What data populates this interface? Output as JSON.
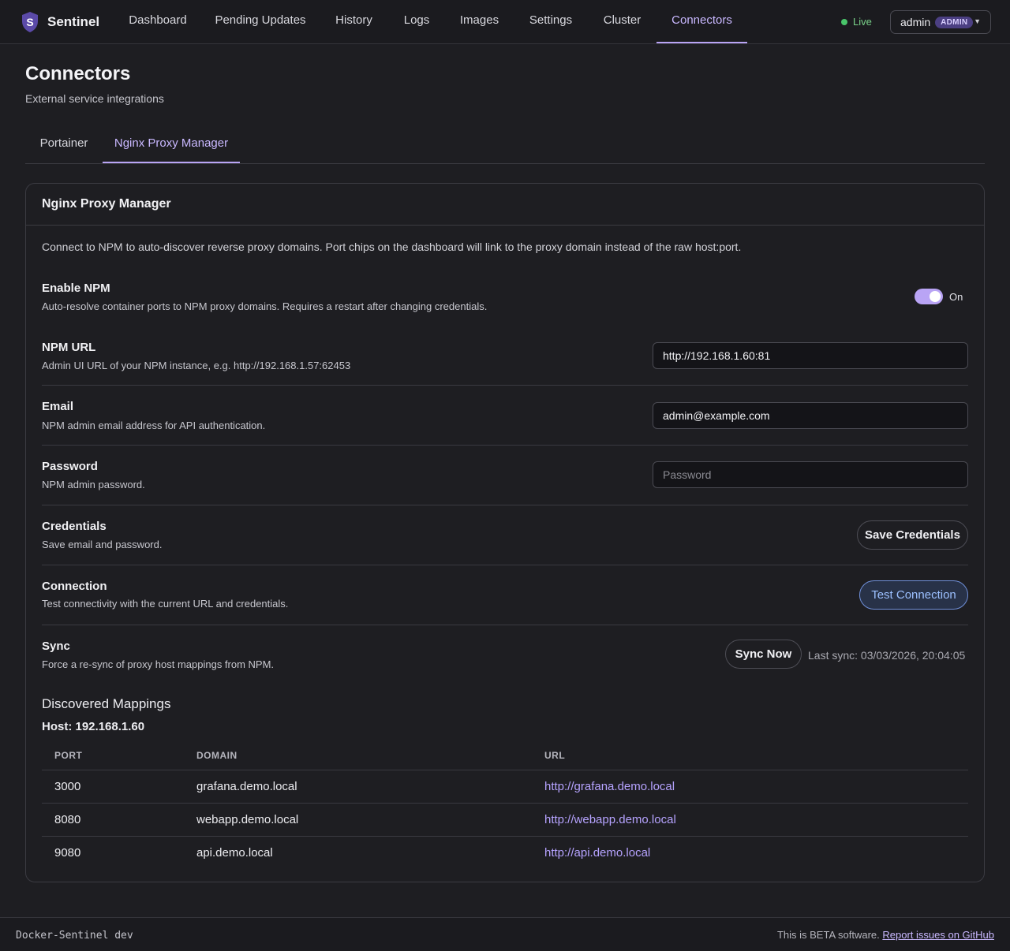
{
  "app": {
    "name": "Sentinel",
    "logo_letter": "S",
    "logo_icon": "shield-icon",
    "accent_color": "#b9a4f5"
  },
  "nav": {
    "items": [
      {
        "label": "Dashboard"
      },
      {
        "label": "Pending Updates"
      },
      {
        "label": "History"
      },
      {
        "label": "Logs"
      },
      {
        "label": "Images"
      },
      {
        "label": "Settings"
      },
      {
        "label": "Cluster"
      },
      {
        "label": "Connectors",
        "active": true
      }
    ],
    "status": "Live",
    "user": {
      "name": "admin",
      "role": "ADMIN",
      "menu_icon": "caret-down-icon"
    }
  },
  "page": {
    "title": "Connectors",
    "subtitle": "External service integrations"
  },
  "tabs": [
    {
      "label": "Portainer"
    },
    {
      "label": "Nginx Proxy Manager",
      "active": true
    }
  ],
  "card": {
    "title": "Nginx Proxy Manager",
    "description": "Connect to NPM to auto-discover reverse proxy domains. Port chips on the dashboard will link to the proxy domain instead of the raw host:port.",
    "enable": {
      "label": "Enable NPM",
      "hint": "Auto-resolve container ports to NPM proxy domains. Requires a restart after changing credentials.",
      "state": "On",
      "enabled": true
    },
    "url": {
      "label": "NPM URL",
      "hint": "Admin UI URL of your NPM instance, e.g. http://192.168.1.57:62453",
      "value": "http://192.168.1.60:81"
    },
    "email": {
      "label": "Email",
      "hint": "NPM admin email address for API authentication.",
      "value": "admin@example.com"
    },
    "password": {
      "label": "Password",
      "hint": "NPM admin password.",
      "placeholder": "Password"
    },
    "credentials": {
      "label": "Credentials",
      "hint": "Save email and password.",
      "button": "Save Credentials"
    },
    "connection": {
      "label": "Connection",
      "hint": "Test connectivity with the current URL and credentials.",
      "button": "Test Connection"
    },
    "sync": {
      "label": "Sync",
      "hint": "Force a re-sync of proxy host mappings from NPM.",
      "button": "Sync Now",
      "last_sync": "Last sync: 03/03/2026, 20:04:05"
    },
    "mappings": {
      "title": "Discovered Mappings",
      "host": "Host: 192.168.1.60",
      "columns": [
        "PORT",
        "DOMAIN",
        "URL"
      ],
      "rows": [
        {
          "port": "3000",
          "domain": "grafana.demo.local",
          "url": "http://grafana.demo.local"
        },
        {
          "port": "8080",
          "domain": "webapp.demo.local",
          "url": "http://webapp.demo.local"
        },
        {
          "port": "9080",
          "domain": "api.demo.local",
          "url": "http://api.demo.local"
        }
      ]
    }
  },
  "footer": {
    "version": "Docker-Sentinel dev",
    "beta_text": "This is BETA software.",
    "report_link": "Report issues on GitHub"
  }
}
